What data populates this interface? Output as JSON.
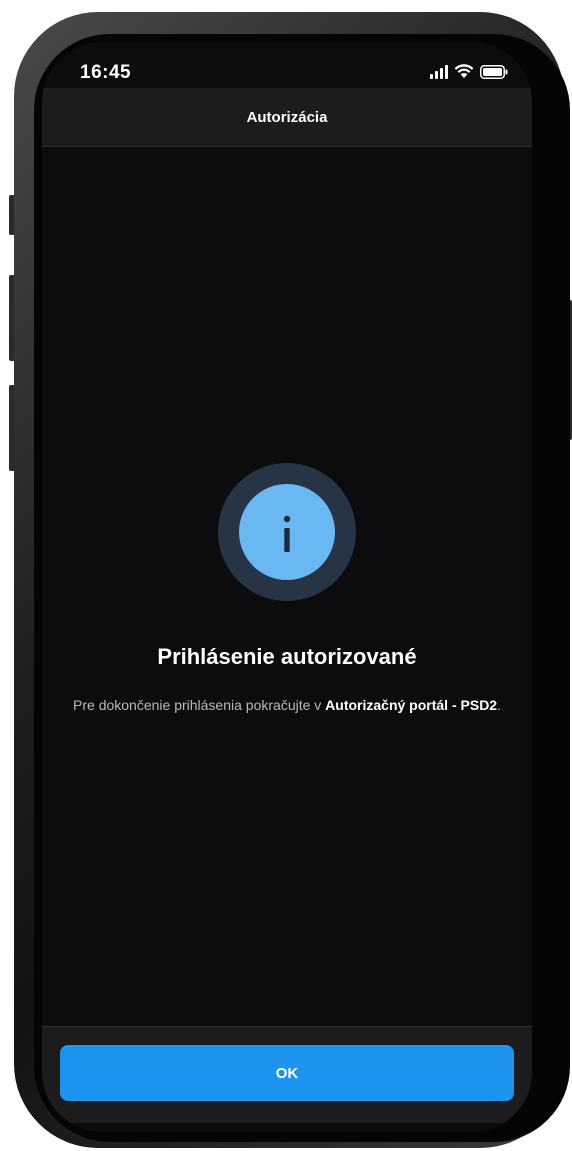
{
  "status_bar": {
    "time": "16:45",
    "icons": [
      "cellular-signal-icon",
      "wifi-icon",
      "battery-icon"
    ]
  },
  "header": {
    "title": "Autorizácia"
  },
  "result": {
    "icon": "info-icon",
    "title": "Prihlásenie autorizované",
    "description_prefix": "Pre dokončenie prihlásenia pokračujte v ",
    "description_link": "Autorizačný portál - PSD2",
    "description_suffix": "."
  },
  "footer": {
    "ok_label": "OK"
  },
  "colors": {
    "background": "#0c0c0e",
    "header": "#1c1c1f",
    "accent": "#1d95ee",
    "info_circle": "#6ab8f2",
    "info_ring": "#263445"
  }
}
